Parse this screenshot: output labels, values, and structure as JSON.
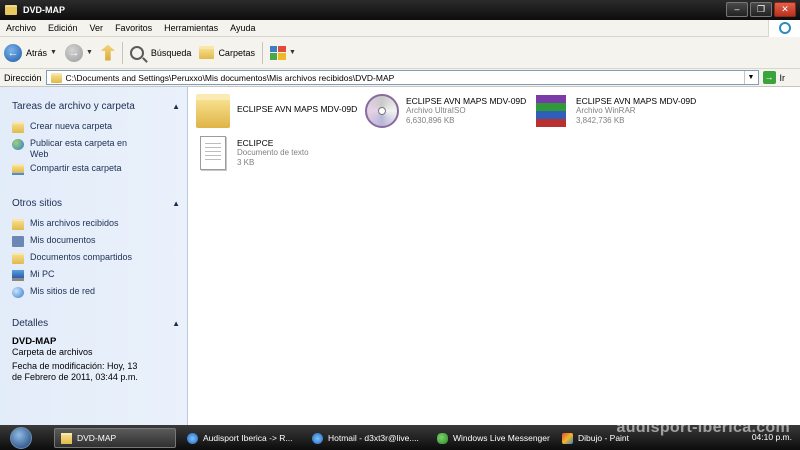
{
  "window": {
    "title": "DVD-MAP"
  },
  "menubar": {
    "items": [
      "Archivo",
      "Edición",
      "Ver",
      "Favoritos",
      "Herramientas",
      "Ayuda"
    ]
  },
  "toolbar": {
    "back_label": "Atrás",
    "search_label": "Búsqueda",
    "folders_label": "Carpetas"
  },
  "addressbar": {
    "label": "Dirección",
    "path": "C:\\Documents and Settings\\Peruxxo\\Mis documentos\\Mis archivos recibidos\\DVD-MAP",
    "go_label": "Ir"
  },
  "sidebar": {
    "tasks": {
      "title": "Tareas de archivo y carpeta",
      "items": [
        {
          "label": "Crear nueva carpeta",
          "icon": "new-folder-icon"
        },
        {
          "label": "Publicar esta carpeta en Web",
          "icon": "publish-web-icon"
        },
        {
          "label": "Compartir esta carpeta",
          "icon": "share-folder-icon"
        }
      ]
    },
    "places": {
      "title": "Otros sitios",
      "items": [
        {
          "label": "Mis archivos recibidos",
          "icon": "folder-icon"
        },
        {
          "label": "Mis documentos",
          "icon": "documents-icon"
        },
        {
          "label": "Documentos compartidos",
          "icon": "folder-icon"
        },
        {
          "label": "Mi PC",
          "icon": "computer-icon"
        },
        {
          "label": "Mis sitios de red",
          "icon": "network-icon"
        }
      ]
    },
    "details": {
      "title": "Detalles",
      "name": "DVD-MAP",
      "type": "Carpeta de archivos",
      "modified_line1": "Fecha de modificación: Hoy, 13",
      "modified_line2": "de Febrero de 2011, 03:44 p.m."
    }
  },
  "files": [
    {
      "name": "ECLIPSE AVN MAPS MDV-09D",
      "type": "",
      "size": "",
      "icon": "folder-icon"
    },
    {
      "name": "ECLIPSE AVN MAPS MDV-09D",
      "type": "Archivo UltraISO",
      "size": "6,630,896 KB",
      "icon": "disc-image-icon"
    },
    {
      "name": "ECLIPSE AVN MAPS MDV-09D",
      "type": "Archivo WinRAR",
      "size": "3,842,736 KB",
      "icon": "winrar-icon"
    },
    {
      "name": "ECLIPCE",
      "type": "Documento de texto",
      "size": "3 KB",
      "icon": "text-document-icon"
    }
  ],
  "taskbar": {
    "buttons": [
      {
        "label": "DVD-MAP",
        "icon": "folder-icon",
        "active": true
      },
      {
        "label": "Audisport Iberica -> R...",
        "icon": "ie-icon"
      },
      {
        "label": "Hotmail - d3xt3r@live....",
        "icon": "ie-icon"
      },
      {
        "label": "Windows Live Messenger",
        "icon": "messenger-icon"
      },
      {
        "label": "Dibujo - Paint",
        "icon": "paint-icon"
      }
    ],
    "clock": "04:10 p.m.",
    "watermark": "audisport-iberica.com"
  }
}
